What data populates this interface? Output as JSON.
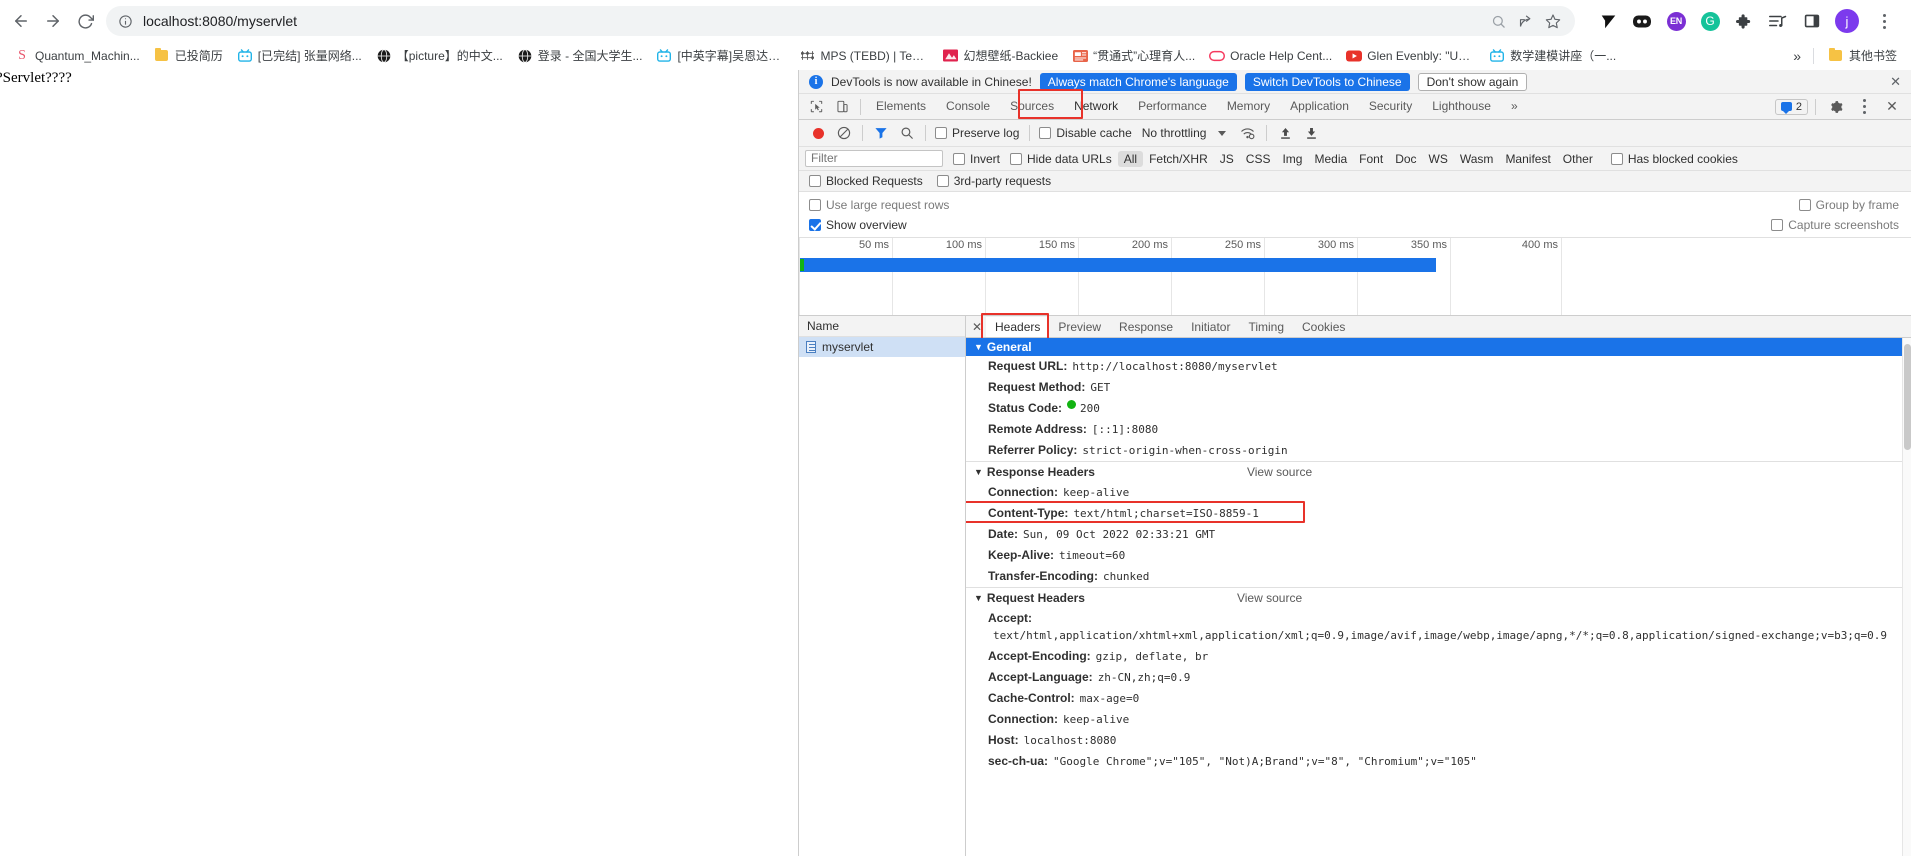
{
  "browser": {
    "back_label": "Back",
    "forward_label": "Forward",
    "reload_label": "Reload",
    "url": "localhost:8080/myservlet",
    "site_info_label": "View site information",
    "search_label": "Search with Google Lens",
    "share_label": "Share this page",
    "bookmark_label": "Bookmark this tab",
    "profile_initial": "j",
    "extensions": [
      {
        "name": "readwise-extension",
        "glyph": "◤"
      },
      {
        "name": "dualsub-extension",
        "glyph": "••"
      },
      {
        "name": "english-extension",
        "glyph": "EN",
        "color": "#7c3aed"
      },
      {
        "name": "grammarly-extension",
        "glyph": "G",
        "color": "#15c39a"
      },
      {
        "name": "extensions-puzzle-icon",
        "glyph": "🧩"
      },
      {
        "name": "playlist-extension",
        "glyph": "♪"
      },
      {
        "name": "sidepanel-icon",
        "glyph": "▯"
      }
    ]
  },
  "bookmarks": {
    "items": [
      {
        "label": "Quantum_Machin...",
        "icon": "S",
        "icon_color": "#e8556c"
      },
      {
        "label": "已投简历",
        "icon": "folder",
        "icon_color": "#f6c244"
      },
      {
        "label": "[已完结] 张量网络...",
        "icon": "bili",
        "icon_color": "#22b4e8"
      },
      {
        "label": "【picture】的中文...",
        "icon": "globe",
        "icon_color": "#222222"
      },
      {
        "label": "登录 - 全国大学生...",
        "icon": "globe",
        "icon_color": "#222222"
      },
      {
        "label": "[中英字幕]吴恩达机...",
        "icon": "bili",
        "icon_color": "#22b4e8"
      },
      {
        "label": "MPS (TEBD) | Tens...",
        "icon": "tensor",
        "icon_color": "#555555"
      },
      {
        "label": "幻想壁纸-Backiee",
        "icon": "pic",
        "icon_color": "#e0234e"
      },
      {
        "label": "“贯通式”心理育人...",
        "icon": "doc",
        "icon_color": "#e8644a"
      },
      {
        "label": "Oracle Help Cent...",
        "icon": "oracle",
        "icon_color": "#f5395e"
      },
      {
        "label": "Glen Evenbly: \"Usi...",
        "icon": "youtube",
        "icon_color": "#e8322a"
      },
      {
        "label": "数学建模讲座（一...",
        "icon": "bili",
        "icon_color": "#22b4e8"
      }
    ],
    "overflow_label": "»",
    "other_bookmarks_label": "其他书签"
  },
  "page": {
    "body_text": "?Servlet????"
  },
  "devtools": {
    "infobar": {
      "message": "DevTools is now available in Chinese!",
      "btn_always": "Always match Chrome's language",
      "btn_switch": "Switch DevTools to Chinese",
      "btn_dont_show": "Don't show again",
      "close_label": "✕"
    },
    "tabs": [
      {
        "label": "Elements",
        "state": "normal"
      },
      {
        "label": "Console",
        "state": "normal"
      },
      {
        "label": "Sources",
        "state": "normal"
      },
      {
        "label": "Network",
        "state": "selected"
      },
      {
        "label": "Performance",
        "state": "normal"
      },
      {
        "label": "Memory",
        "state": "normal"
      },
      {
        "label": "Application",
        "state": "normal"
      },
      {
        "label": "Security",
        "state": "normal"
      },
      {
        "label": "Lighthouse",
        "state": "normal"
      }
    ],
    "more_tabs_label": "»",
    "issues_count": "2",
    "settings_label": "Settings",
    "more_options_label": "More options",
    "close_label": "✕",
    "inspect_label": "Inspect element",
    "device_toolbar_label": "Toggle device toolbar",
    "toolbar": {
      "record_label": "Stop recording network log",
      "clear_label": "Clear network log",
      "filter_label": "Filter",
      "search_label": "Search",
      "preserve_log": "Preserve log",
      "disable_cache": "Disable cache",
      "throttling": "No throttling",
      "import_label": "Import HAR file",
      "export_label": "Export HAR file"
    },
    "filterbar": {
      "filter_placeholder": "Filter",
      "invert": "Invert",
      "hide_data_urls": "Hide data URLs",
      "types": [
        "All",
        "Fetch/XHR",
        "JS",
        "CSS",
        "Img",
        "Media",
        "Font",
        "Doc",
        "WS",
        "Wasm",
        "Manifest",
        "Other"
      ],
      "selected_type": "All",
      "has_blocked_cookies": "Has blocked cookies",
      "blocked_requests": "Blocked Requests",
      "third_party_requests": "3rd-party requests"
    },
    "options": {
      "use_large_rows": "Use large request rows",
      "group_by_frame": "Group by frame",
      "show_overview": "Show overview",
      "capture_screenshots": "Capture screenshots"
    },
    "overview": {
      "ticks": [
        "50 ms",
        "100 ms",
        "150 ms",
        "200 ms",
        "250 ms",
        "300 ms",
        "350 ms",
        "400 ms"
      ]
    },
    "request_list": {
      "column_name": "Name",
      "rows": [
        {
          "name": "myservlet"
        }
      ]
    },
    "detail_tabs": [
      {
        "label": "Headers",
        "state": "selected"
      },
      {
        "label": "Preview",
        "state": "normal"
      },
      {
        "label": "Response",
        "state": "normal"
      },
      {
        "label": "Initiator",
        "state": "normal"
      },
      {
        "label": "Timing",
        "state": "normal"
      },
      {
        "label": "Cookies",
        "state": "normal"
      }
    ],
    "sections": {
      "general": {
        "title": "General",
        "rows": [
          {
            "name": "Request URL:",
            "value": "http://localhost:8080/myservlet"
          },
          {
            "name": "Request Method:",
            "value": "GET"
          },
          {
            "name": "Status Code:",
            "value": "200",
            "status_dot": true
          },
          {
            "name": "Remote Address:",
            "value": "[::1]:8080"
          },
          {
            "name": "Referrer Policy:",
            "value": "strict-origin-when-cross-origin"
          }
        ]
      },
      "response_headers": {
        "title": "Response Headers",
        "view_source": "View source",
        "rows": [
          {
            "name": "Connection:",
            "value": "keep-alive"
          },
          {
            "name": "Content-Type:",
            "value": "text/html;charset=ISO-8859-1",
            "highlighted": true
          },
          {
            "name": "Date:",
            "value": "Sun, 09 Oct 2022 02:33:21 GMT"
          },
          {
            "name": "Keep-Alive:",
            "value": "timeout=60"
          },
          {
            "name": "Transfer-Encoding:",
            "value": "chunked"
          }
        ]
      },
      "request_headers": {
        "title": "Request Headers",
        "view_source": "View source",
        "rows": [
          {
            "name": "Accept:",
            "value": "text/html,application/xhtml+xml,application/xml;q=0.9,image/avif,image/webp,image/apng,*/*;q=0.8,application/signed-exchange;v=b3;q=0.9"
          },
          {
            "name": "Accept-Encoding:",
            "value": "gzip, deflate, br"
          },
          {
            "name": "Accept-Language:",
            "value": "zh-CN,zh;q=0.9"
          },
          {
            "name": "Cache-Control:",
            "value": "max-age=0"
          },
          {
            "name": "Connection:",
            "value": "keep-alive"
          },
          {
            "name": "Host:",
            "value": "localhost:8080"
          },
          {
            "name": "sec-ch-ua:",
            "value": "\"Google Chrome\";v=\"105\", \"Not)A;Brand\";v=\"8\", \"Chromium\";v=\"105\""
          }
        ]
      }
    }
  },
  "colors": {
    "accent_blue": "#1a73e8",
    "highlight_red": "#e8322a",
    "status_green": "#12b312"
  }
}
